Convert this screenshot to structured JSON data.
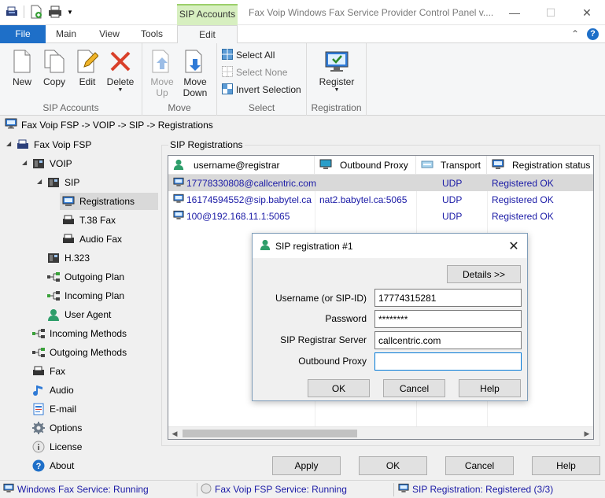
{
  "window": {
    "title": "Fax Voip Windows Fax Service Provider Control Panel v....",
    "contextual_tab_group": "SIP Accounts"
  },
  "ribbon_tabs": [
    "File",
    "Main",
    "View",
    "Tools",
    "Edit"
  ],
  "ribbon": {
    "groups": {
      "sip_accounts": "SIP Accounts",
      "move": "Move",
      "select": "Select",
      "registration": "Registration"
    },
    "buttons": {
      "new": "New",
      "copy": "Copy",
      "edit": "Edit",
      "delete": "Delete",
      "move_up_1": "Move",
      "move_up_2": "Up",
      "move_down_1": "Move",
      "move_down_2": "Down",
      "select_all": "Select All",
      "select_none": "Select None",
      "invert_selection": "Invert Selection",
      "register": "Register"
    }
  },
  "breadcrumb": "Fax Voip FSP -> VOIP -> SIP -> Registrations",
  "tree": {
    "root": "Fax Voip FSP",
    "voip": "VOIP",
    "sip": "SIP",
    "registrations": "Registrations",
    "t38": "T.38 Fax",
    "audio_fax": "Audio Fax",
    "h323": "H.323",
    "outgoing_plan": "Outgoing Plan",
    "incoming_plan": "Incoming Plan",
    "user_agent": "User Agent",
    "incoming_methods": "Incoming Methods",
    "outgoing_methods": "Outgoing Methods",
    "fax": "Fax",
    "audio": "Audio",
    "email": "E-mail",
    "options": "Options",
    "license": "License",
    "about": "About"
  },
  "panel": {
    "title": "SIP Registrations",
    "columns": [
      "username@registrar",
      "Outbound Proxy",
      "Transport",
      "Registration status"
    ],
    "rows": [
      {
        "user": "17778330808@callcentric.com",
        "proxy": "",
        "transport": "UDP",
        "status": "Registered OK"
      },
      {
        "user": "16174594552@sip.babytel.ca",
        "proxy": "nat2.babytel.ca:5065",
        "transport": "UDP",
        "status": "Registered OK"
      },
      {
        "user": "100@192.168.11.1:5065",
        "proxy": "",
        "transport": "UDP",
        "status": "Registered OK"
      }
    ]
  },
  "dialog": {
    "title": "SIP registration #1",
    "details_button": "Details >>",
    "fields": {
      "username_label": "Username (or SIP-ID)",
      "username_value": "17774315281",
      "password_label": "Password",
      "password_value": "********",
      "registrar_label": "SIP Registrar Server",
      "registrar_value": "callcentric.com",
      "proxy_label": "Outbound Proxy",
      "proxy_value": ""
    },
    "ok": "OK",
    "cancel": "Cancel",
    "help": "Help"
  },
  "bottom_buttons": {
    "apply": "Apply",
    "ok": "OK",
    "cancel": "Cancel",
    "help": "Help"
  },
  "status_bar": {
    "fax_service": "Windows Fax Service: Running",
    "fsp_service": "Fax Voip FSP Service: Running",
    "sip_registration": "SIP Registration: Registered (3/3)"
  },
  "colors": {
    "file_tab": "#1e6fc8",
    "contextual_tab": "#d7efc0",
    "link_text": "#1a1aa6",
    "selection": "#d9d9d9"
  }
}
